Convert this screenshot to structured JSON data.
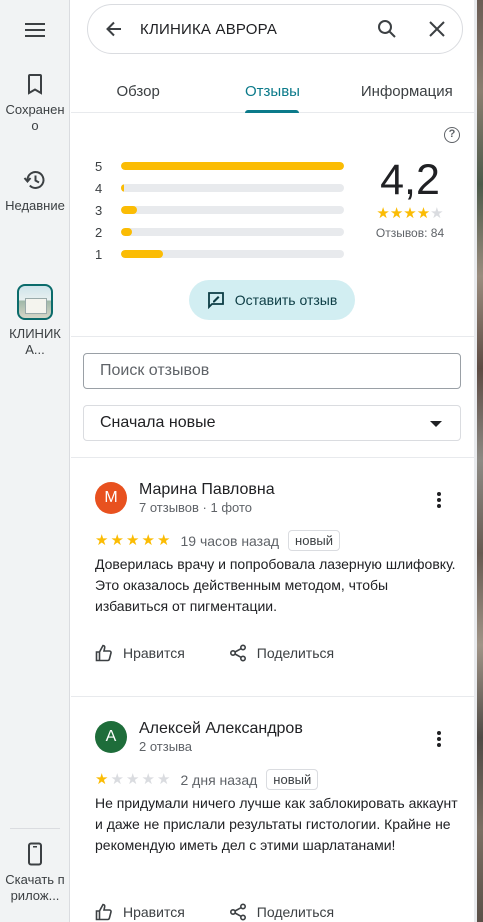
{
  "rail": {
    "saved_label": "Сохранено",
    "recent_label": "Недавние",
    "place_label": "КЛИНИК А...",
    "download_label": "Скачать прилож..."
  },
  "search": {
    "query": "КЛИНИКА АВРОРА"
  },
  "tabs": [
    {
      "label": "Обзор",
      "active": false
    },
    {
      "label": "Отзывы",
      "active": true
    },
    {
      "label": "Информация",
      "active": false
    }
  ],
  "summary": {
    "rating": "4,2",
    "stars_filled": 4,
    "stars_total": 5,
    "count_text": "Отзывов: 84",
    "histogram": [
      {
        "label": "5",
        "fraction": 1.0
      },
      {
        "label": "4",
        "fraction": 0.01
      },
      {
        "label": "3",
        "fraction": 0.07
      },
      {
        "label": "2",
        "fraction": 0.05
      },
      {
        "label": "1",
        "fraction": 0.19
      }
    ],
    "write_review_label": "Оставить отзыв"
  },
  "filters": {
    "search_placeholder": "Поиск отзывов",
    "sort_value": "Сначала новые"
  },
  "reviews": [
    {
      "avatar_letter": "М",
      "avatar_color": "#e8511f",
      "name": "Марина Павловна",
      "meta": "7 отзывов · 1 фото",
      "stars": 5,
      "time": "19 часов назад",
      "badge": "новый",
      "text": "Доверилась врачу и попробовала лазерную шлифовку. Это оказалось действенным методом, чтобы избавиться от пигментации.",
      "like_label": "Нравится",
      "share_label": "Поделиться"
    },
    {
      "avatar_letter": "А",
      "avatar_color": "#1e6d3a",
      "name": "Алексей Александров",
      "meta": "2 отзыва",
      "stars": 1,
      "time": "2 дня назад",
      "badge": "новый",
      "text": "Не придумали ничего лучше как заблокировать аккаунт и даже не прислали результаты гистологии. Крайне не рекомендую иметь дел с этими шарлатанами!",
      "like_label": "Нравится",
      "share_label": "Поделиться"
    }
  ]
}
